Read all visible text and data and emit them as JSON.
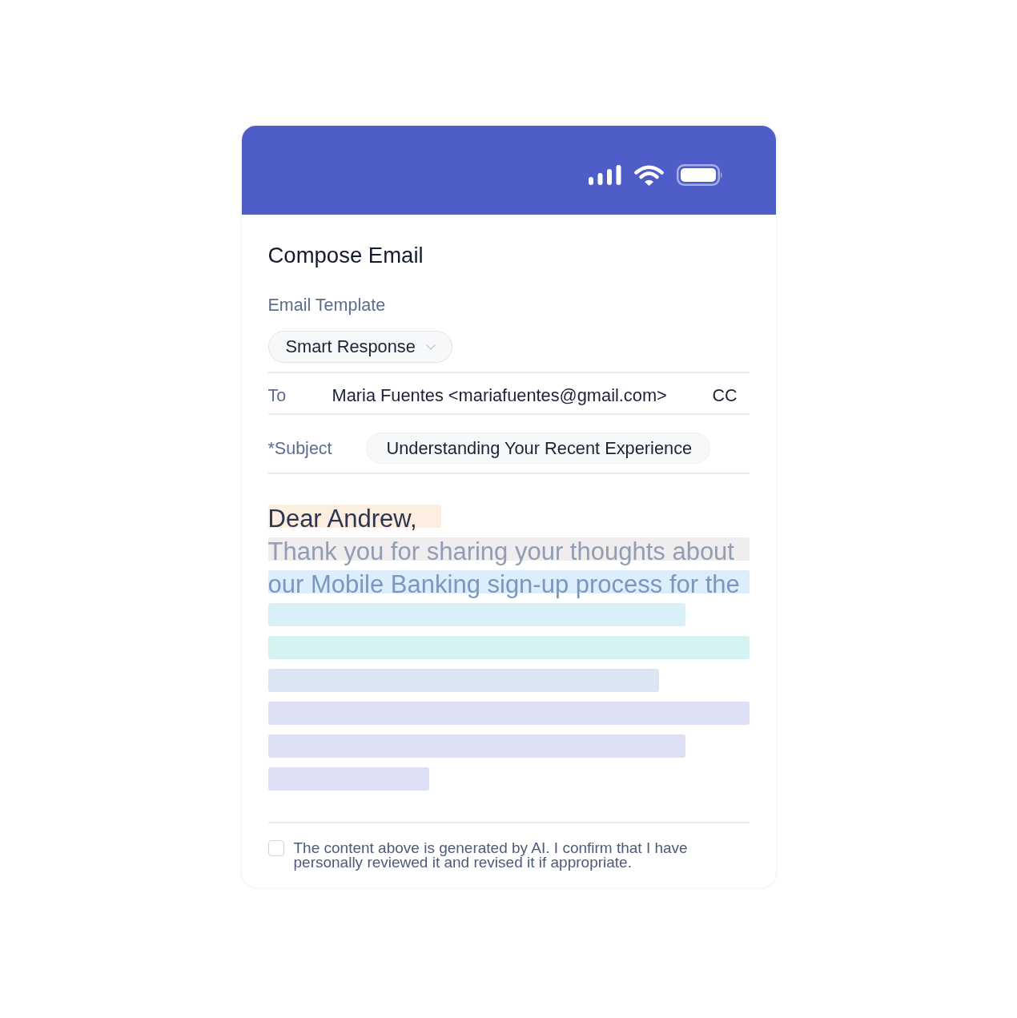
{
  "title": "Compose Email",
  "template": {
    "label": "Email Template",
    "value": "Smart Response"
  },
  "to": {
    "label": "To",
    "value": "Maria Fuentes <mariafuentes@gmail.com>",
    "cc": "CC"
  },
  "subject": {
    "label": "*Subject",
    "value": "Understanding Your Recent Experience"
  },
  "body": {
    "lines": [
      {
        "kind": "greeting",
        "text": "Dear Andrew,",
        "color": "#fdeee2"
      },
      {
        "kind": "paragraph",
        "text": "Thank you for sharing your thoughts about",
        "color": "#efedee"
      },
      {
        "kind": "paragraph",
        "text": "our Mobile Banking sign-up process for the",
        "color": "#dcedfb"
      }
    ],
    "bars": [
      {
        "kind": "long",
        "color": "#d8f0f8"
      },
      {
        "kind": "full",
        "color": "#d4f3f2"
      },
      {
        "kind": "medium",
        "color": "#dce6f2"
      },
      {
        "kind": "full",
        "color": "#dee0f5"
      },
      {
        "kind": "long",
        "color": "#dee0f5"
      },
      {
        "kind": "short",
        "color": "#dee0f5"
      }
    ]
  },
  "confirmation": {
    "text": "The content above is generated by AI. I confirm that I have personally reviewed it and revised it if appropriate.",
    "checked": false
  }
}
